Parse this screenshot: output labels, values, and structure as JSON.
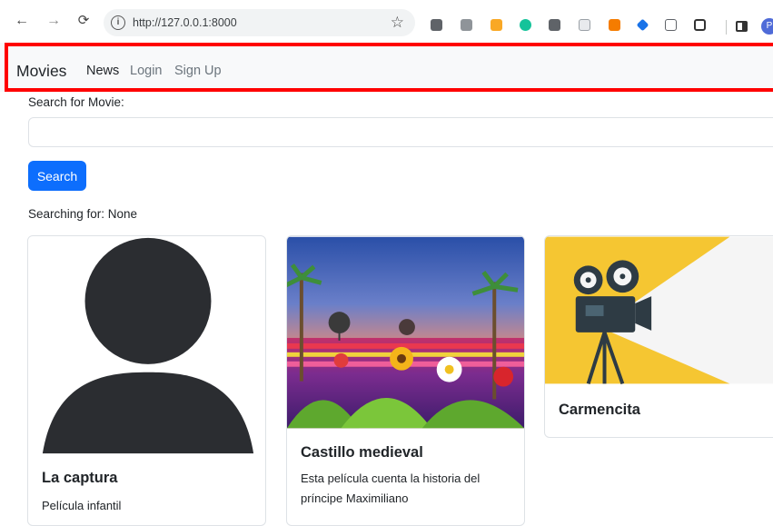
{
  "browser": {
    "url": "http://127.0.0.1:8000",
    "profile_initial": "P"
  },
  "navbar": {
    "brand": "Movies",
    "links": [
      {
        "label": "News",
        "active": true
      },
      {
        "label": "Login",
        "active": false
      },
      {
        "label": "Sign Up",
        "active": false
      }
    ]
  },
  "search": {
    "label": "Search for Movie:",
    "value": "",
    "button_label": "Search",
    "status": "Searching for: None"
  },
  "movies": [
    {
      "title": "La captura",
      "description": "Película infantil",
      "image": "person-placeholder"
    },
    {
      "title": "Castillo medieval",
      "description": "Esta película cuenta la historia del príncipe Maximiliano",
      "image": "flower-landscape"
    },
    {
      "title": "Carmencita",
      "description": "",
      "image": "film-camera"
    }
  ],
  "colors": {
    "primary": "#0d6efd",
    "navbar_bg": "#f8f9fa",
    "highlight": "#ff0000",
    "camera_yellow": "#f5c632"
  }
}
